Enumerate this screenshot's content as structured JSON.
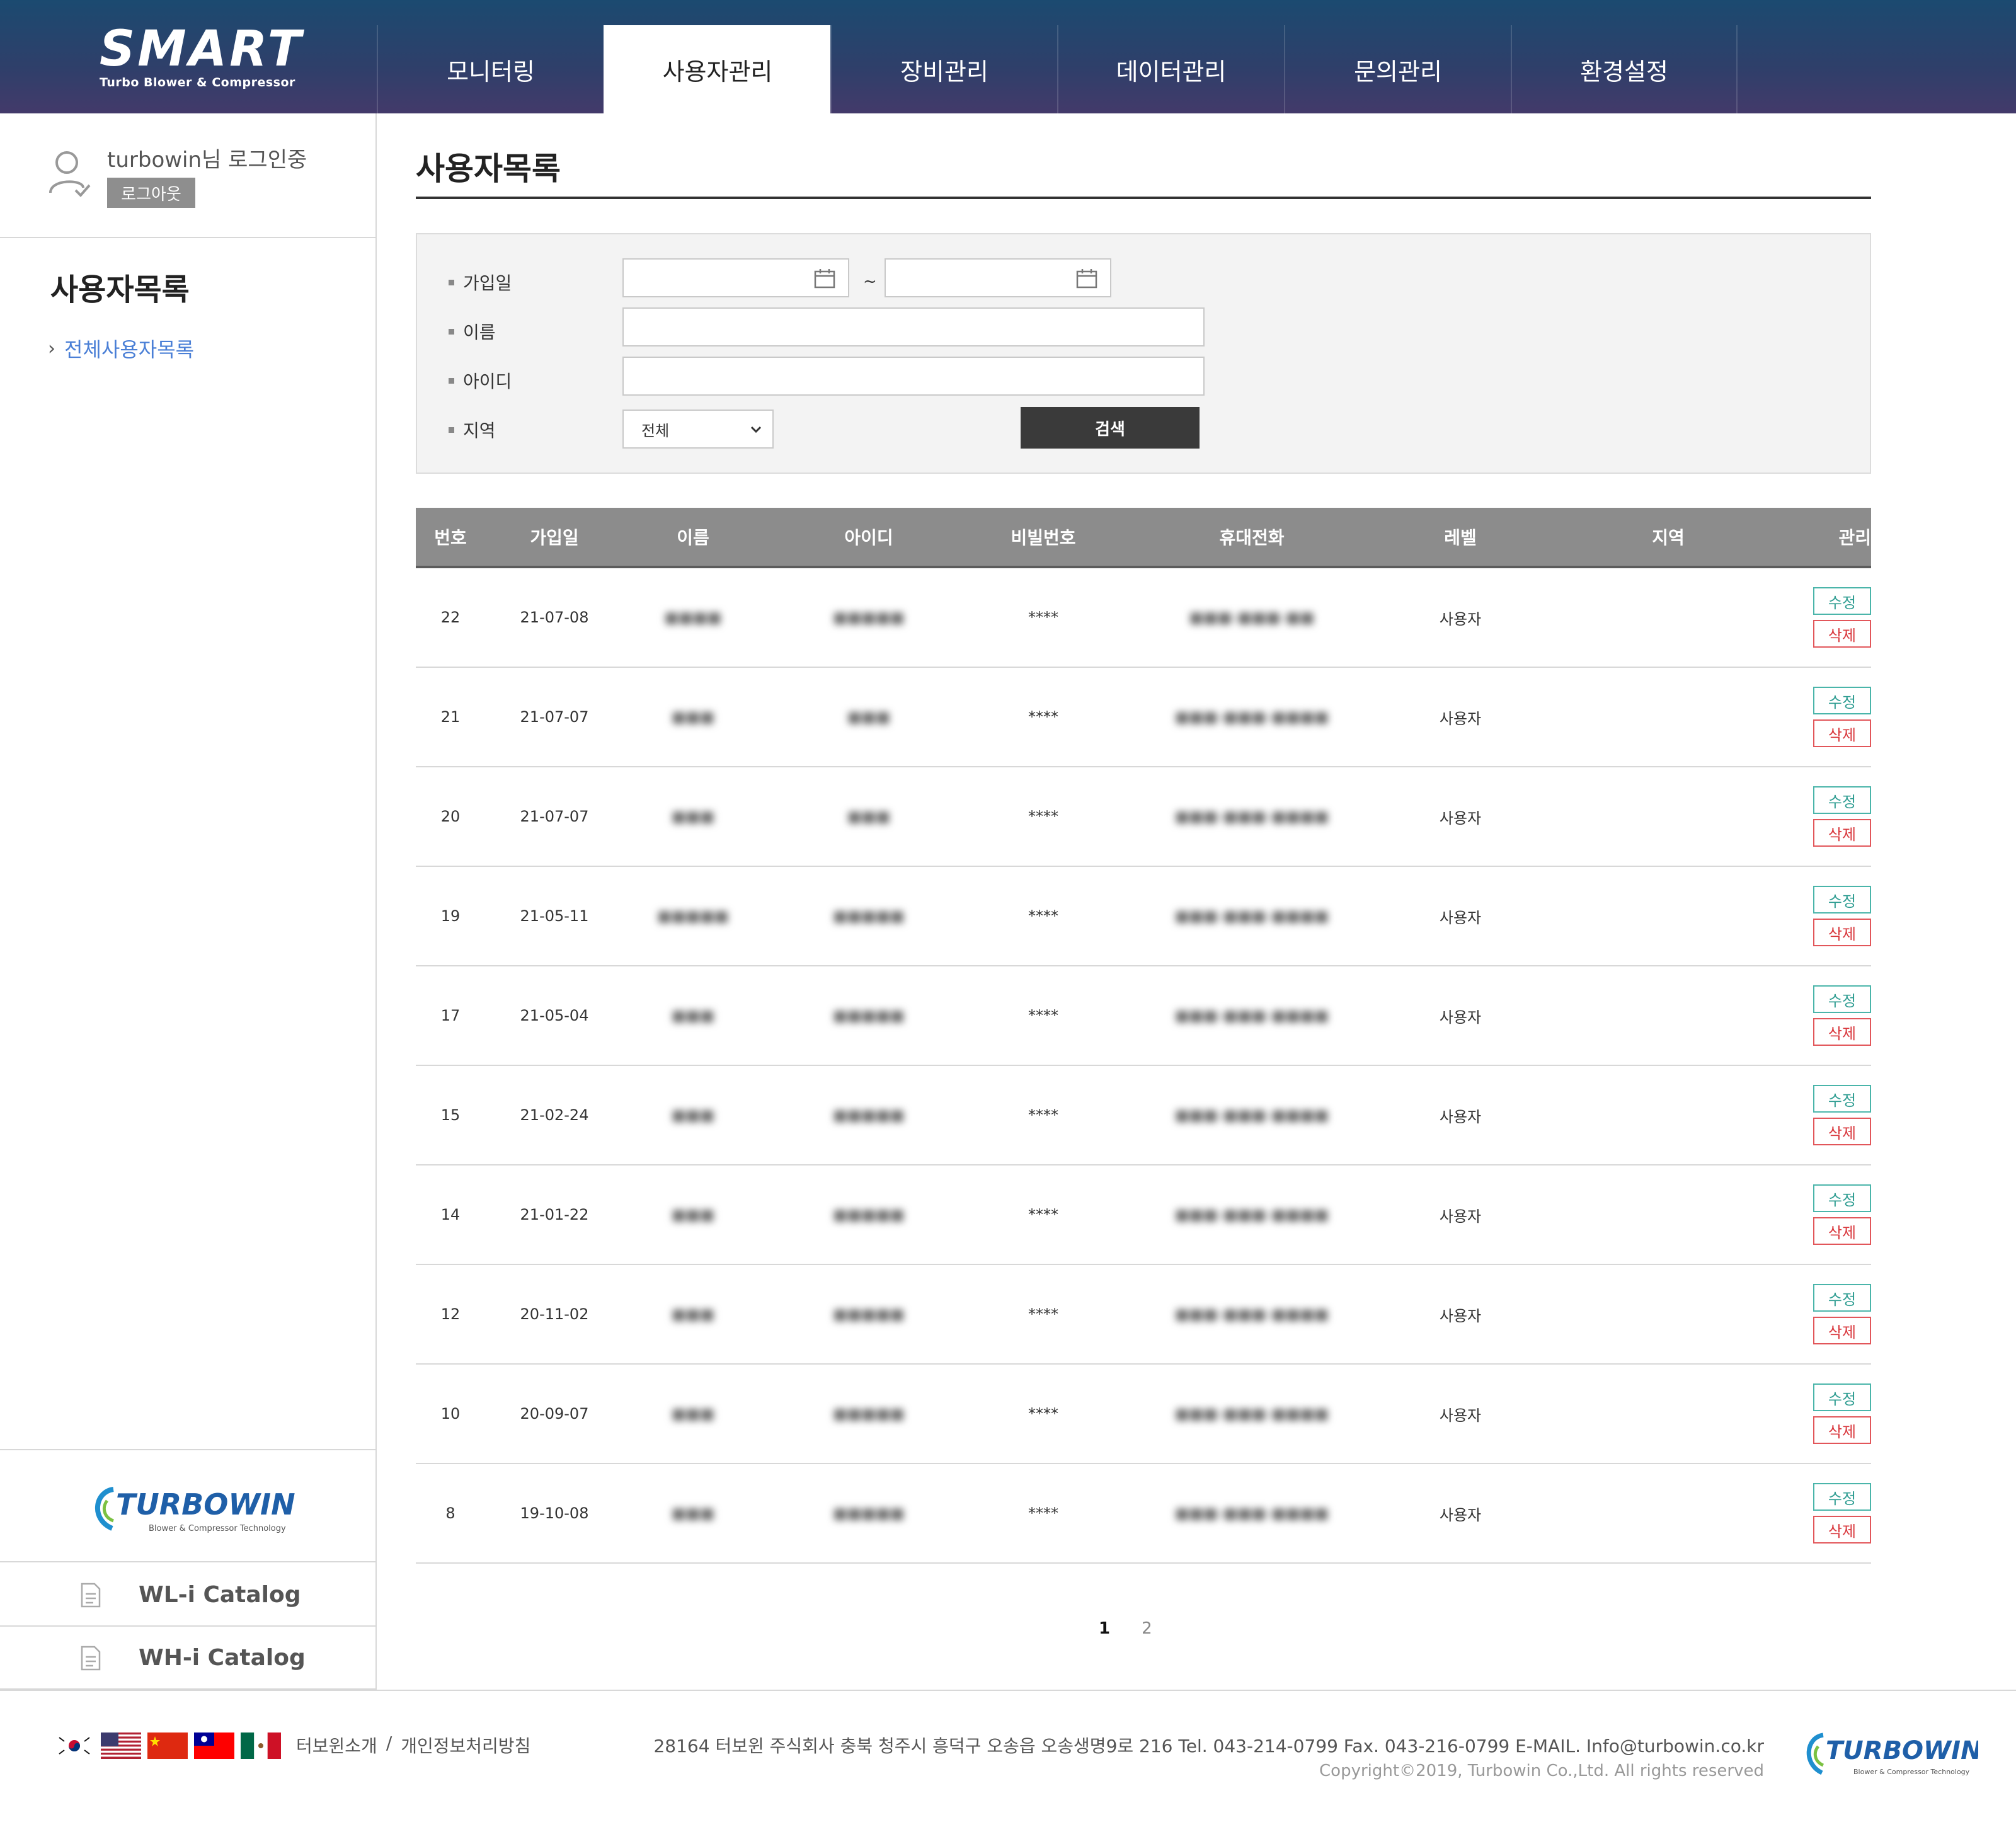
{
  "header": {
    "logo_text": "SMART",
    "logo_sub": "Turbo Blower & Compressor",
    "nav": [
      {
        "label": "모니터링"
      },
      {
        "label": "사용자관리"
      },
      {
        "label": "장비관리"
      },
      {
        "label": "데이터관리"
      },
      {
        "label": "문의관리"
      },
      {
        "label": "환경설정"
      }
    ],
    "active_nav": "사용자관리"
  },
  "sidebar": {
    "user_text": "turbowin님 로그인중",
    "logout_label": "로그아웃",
    "section_title": "사용자목록",
    "links": [
      {
        "label": "전체사용자목록"
      }
    ],
    "brand_logo": "TURBOWIN",
    "brand_sub": "Blower & Compressor Technology",
    "catalogs": [
      {
        "label": "WL-i Catalog"
      },
      {
        "label": "WH-i Catalog"
      }
    ]
  },
  "main": {
    "title": "사용자목록",
    "search": {
      "join_date_label": "가입일",
      "date_separator": "~",
      "name_label": "이름",
      "id_label": "아이디",
      "region_label": "지역",
      "region_selected": "전체",
      "search_button": "검색"
    },
    "table": {
      "headers": [
        "번호",
        "가입일",
        "이름",
        "아이디",
        "비빌번호",
        "휴대전화",
        "레벨",
        "지역",
        "관리"
      ],
      "edit_label": "수정",
      "delete_label": "삭제",
      "rows": [
        {
          "no": "22",
          "date": "21-07-08",
          "name": "■■■■",
          "id": "■■■■■",
          "pw": "****",
          "phone": "■■■-■■■-■■",
          "level": "사용자",
          "region": ""
        },
        {
          "no": "21",
          "date": "21-07-07",
          "name": "■■■",
          "id": "■■■",
          "pw": "****",
          "phone": "■■■-■■■-■■■■",
          "level": "사용자",
          "region": ""
        },
        {
          "no": "20",
          "date": "21-07-07",
          "name": "■■■",
          "id": "■■■",
          "pw": "****",
          "phone": "■■■-■■■-■■■■",
          "level": "사용자",
          "region": ""
        },
        {
          "no": "19",
          "date": "21-05-11",
          "name": "■■■■■",
          "id": "■■■■■",
          "pw": "****",
          "phone": "■■■-■■■-■■■■",
          "level": "사용자",
          "region": ""
        },
        {
          "no": "17",
          "date": "21-05-04",
          "name": "■■■",
          "id": "■■■■■",
          "pw": "****",
          "phone": "■■■-■■■-■■■■",
          "level": "사용자",
          "region": ""
        },
        {
          "no": "15",
          "date": "21-02-24",
          "name": "■■■",
          "id": "■■■■■",
          "pw": "****",
          "phone": "■■■-■■■-■■■■",
          "level": "사용자",
          "region": ""
        },
        {
          "no": "14",
          "date": "21-01-22",
          "name": "■■■",
          "id": "■■■■■",
          "pw": "****",
          "phone": "■■■-■■■-■■■■",
          "level": "사용자",
          "region": ""
        },
        {
          "no": "12",
          "date": "20-11-02",
          "name": "■■■",
          "id": "■■■■■",
          "pw": "****",
          "phone": "■■■-■■■-■■■■",
          "level": "사용자",
          "region": ""
        },
        {
          "no": "10",
          "date": "20-09-07",
          "name": "■■■",
          "id": "■■■■■",
          "pw": "****",
          "phone": "■■■-■■■-■■■■",
          "level": "사용자",
          "region": ""
        },
        {
          "no": "8",
          "date": "19-10-08",
          "name": "■■■",
          "id": "■■■■■",
          "pw": "****",
          "phone": "■■■-■■■-■■■■",
          "level": "사용자",
          "region": ""
        }
      ]
    },
    "pagination": {
      "pages": [
        "1",
        "2"
      ],
      "current": "1"
    }
  },
  "footer": {
    "links": [
      "터보윈소개",
      "/",
      "개인정보처리방침"
    ],
    "info": "28164 터보윈 주식회사 충북 청주시 흥덕구 오송읍 오송생명9로 216    Tel. 043-214-0799    Fax. 043-216-0799    E-MAIL. Info@turbowin.co.kr",
    "copyright": "Copyright©2019, Turbowin Co.,Ltd. All rights reserved",
    "flags": [
      "korea-flag",
      "usa-flag",
      "china-flag",
      "taiwan-flag",
      "mexico-flag"
    ]
  },
  "colors": {
    "header_top": "#1b4a70",
    "header_bottom": "#433a6a",
    "accent_link": "#4a7fd6",
    "edit": "#2f9d92",
    "delete": "#d9393e",
    "table_header": "#8c8c8c"
  }
}
